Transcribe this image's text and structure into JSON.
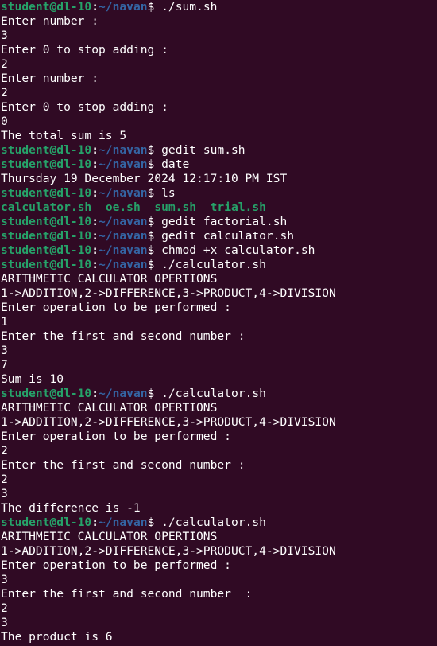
{
  "terminal": {
    "prompt": {
      "user_host": "student@dl-10",
      "colon": ":",
      "path": "~/navan",
      "dollar": "$"
    },
    "colors": {
      "background": "#300a24",
      "prompt_user": "#26a269",
      "prompt_path": "#3465a4",
      "text": "#ffffff",
      "ls_executable": "#26a269"
    },
    "lines": [
      {
        "kind": "prompt",
        "cmd": " ./sum.sh"
      },
      {
        "kind": "out",
        "text": "Enter number :"
      },
      {
        "kind": "out",
        "text": "3"
      },
      {
        "kind": "out",
        "text": "Enter 0 to stop adding :"
      },
      {
        "kind": "out",
        "text": "2"
      },
      {
        "kind": "out",
        "text": "Enter number :"
      },
      {
        "kind": "out",
        "text": "2"
      },
      {
        "kind": "out",
        "text": "Enter 0 to stop adding :"
      },
      {
        "kind": "out",
        "text": "0"
      },
      {
        "kind": "out",
        "text": "The total sum is 5"
      },
      {
        "kind": "prompt",
        "cmd": " gedit sum.sh"
      },
      {
        "kind": "prompt",
        "cmd": " date"
      },
      {
        "kind": "out",
        "text": "Thursday 19 December 2024 12:17:10 PM IST"
      },
      {
        "kind": "prompt",
        "cmd": " ls"
      },
      {
        "kind": "ls",
        "files": [
          "calculator.sh",
          "oe.sh",
          "sum.sh",
          "trial.sh"
        ]
      },
      {
        "kind": "prompt",
        "cmd": " gedit factorial.sh"
      },
      {
        "kind": "prompt",
        "cmd": " gedit calculator.sh"
      },
      {
        "kind": "prompt",
        "cmd": " chmod +x calculator.sh"
      },
      {
        "kind": "prompt",
        "cmd": " ./calculator.sh"
      },
      {
        "kind": "out",
        "text": "ARITHMETIC CALCULATOR OPERTIONS"
      },
      {
        "kind": "out",
        "text": "1->ADDITION,2->DIFFERENCE,3->PRODUCT,4->DIVISION"
      },
      {
        "kind": "out",
        "text": "Enter operation to be performed :"
      },
      {
        "kind": "out",
        "text": "1"
      },
      {
        "kind": "out",
        "text": "Enter the first and second number :"
      },
      {
        "kind": "out",
        "text": "3"
      },
      {
        "kind": "out",
        "text": "7"
      },
      {
        "kind": "out",
        "text": "Sum is 10"
      },
      {
        "kind": "prompt",
        "cmd": " ./calculator.sh"
      },
      {
        "kind": "out",
        "text": "ARITHMETIC CALCULATOR OPERTIONS"
      },
      {
        "kind": "out",
        "text": "1->ADDITION,2->DIFFERENCE,3->PRODUCT,4->DIVISION"
      },
      {
        "kind": "out",
        "text": "Enter operation to be performed :"
      },
      {
        "kind": "out",
        "text": "2"
      },
      {
        "kind": "out",
        "text": "Enter the first and second number :"
      },
      {
        "kind": "out",
        "text": "2"
      },
      {
        "kind": "out",
        "text": "3"
      },
      {
        "kind": "out",
        "text": "The difference is -1"
      },
      {
        "kind": "prompt",
        "cmd": " ./calculator.sh"
      },
      {
        "kind": "out",
        "text": "ARITHMETIC CALCULATOR OPERTIONS"
      },
      {
        "kind": "out",
        "text": "1->ADDITION,2->DIFFERENCE,3->PRODUCT,4->DIVISION"
      },
      {
        "kind": "out",
        "text": "Enter operation to be performed :"
      },
      {
        "kind": "out",
        "text": "3"
      },
      {
        "kind": "out",
        "text": "Enter the first and second number  :"
      },
      {
        "kind": "out",
        "text": "2"
      },
      {
        "kind": "out",
        "text": "3"
      },
      {
        "kind": "out",
        "text": "The product is 6"
      }
    ]
  }
}
